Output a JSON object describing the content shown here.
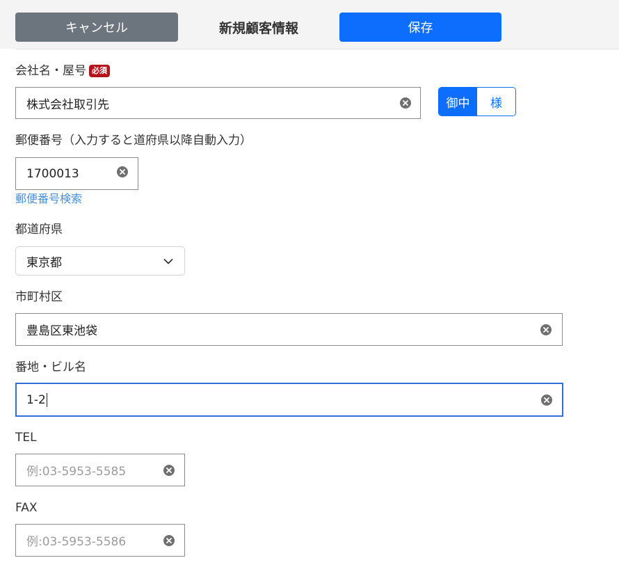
{
  "header": {
    "cancel_label": "キャンセル",
    "title": "新規顧客情報",
    "save_label": "保存"
  },
  "form": {
    "company": {
      "label": "会社名・屋号",
      "required_badge": "必須",
      "value": "株式会社取引先",
      "honorific_options": [
        "御中",
        "様"
      ],
      "honorific_selected": "御中"
    },
    "postal": {
      "label": "郵便番号（入力すると道府県以降自動入力）",
      "value": "1700013",
      "search_link": "郵便番号検索"
    },
    "prefecture": {
      "label": "都道府県",
      "value": "東京都"
    },
    "city": {
      "label": "市町村区",
      "value": "豊島区東池袋"
    },
    "address": {
      "label": "番地・ビル名",
      "value": "1-2"
    },
    "tel": {
      "label": "TEL",
      "placeholder": "例:03-5953-5585"
    },
    "fax": {
      "label": "FAX",
      "placeholder": "例:03-5953-5586"
    }
  },
  "colors": {
    "primary": "#0d6efd",
    "secondary": "#6c757d",
    "required": "#b5121b",
    "link": "#4a8fd8",
    "focus_border": "#2f6fd6"
  }
}
